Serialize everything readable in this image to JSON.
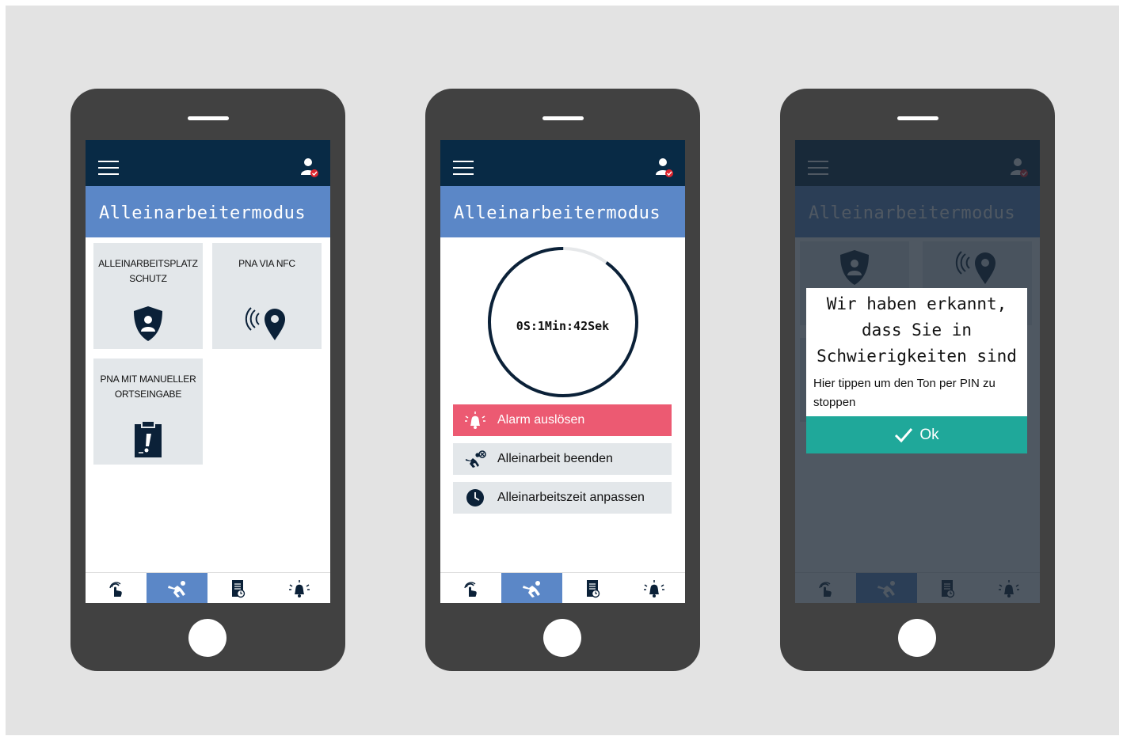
{
  "app": {
    "title": "Alleinarbeitermodus",
    "colors": {
      "topbar": "#082a45",
      "titlebar": "#5b87c7",
      "tile": "#e3e7ea",
      "alarm": "#ec5a72",
      "ok": "#1fa89a",
      "badge": "#e0262f"
    }
  },
  "screen1": {
    "tiles": [
      {
        "label": "ALLEINARBEITSPLATZ SCHUTZ",
        "icon": "shield-person-icon"
      },
      {
        "label": "PNA VIA NFC",
        "icon": "nfc-location-pin-icon"
      },
      {
        "label": "PNA MIT MANUELLER ORTSEINGABE",
        "icon": "clipboard-alert-icon"
      }
    ]
  },
  "screen2": {
    "timer": {
      "text": "0S:1Min:42Sek",
      "progress": 0.9
    },
    "actions": [
      {
        "label": "Alarm auslösen",
        "icon": "alarm-bell-icon"
      },
      {
        "label": "Alleinarbeit beenden",
        "icon": "worker-end-icon"
      },
      {
        "label": "Alleinarbeitszeit anpassen",
        "icon": "clock-icon"
      }
    ]
  },
  "screen3": {
    "dialog": {
      "line1": "Wir haben erkannt,",
      "line2": "dass Sie in",
      "line3": "Schwierigkeiten sind",
      "message": "Hier tippen um den Ton per PIN zu stoppen",
      "ok_label": "Ok"
    }
  },
  "nav": {
    "items": [
      {
        "icon": "touch-hand-icon"
      },
      {
        "icon": "falling-worker-icon",
        "active": true
      },
      {
        "icon": "document-timer-icon"
      },
      {
        "icon": "alarm-bell-icon"
      }
    ]
  }
}
